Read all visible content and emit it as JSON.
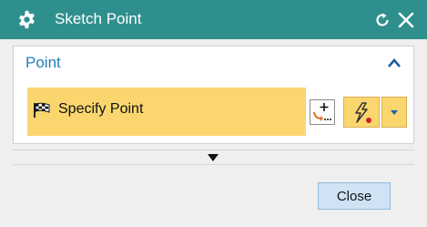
{
  "window": {
    "title": "Sketch Point",
    "icons": [
      "gear-icon",
      "reset-icon",
      "close-icon"
    ]
  },
  "group": {
    "title": "Point",
    "collapse_icon": "chevron-up-icon"
  },
  "specify_point": {
    "label": "Specify Point",
    "icon": "checkered-flag-icon",
    "point_dialog_icon": "point-dialog-icon",
    "snap_icon": "lightning-snap-icon",
    "dropdown_icon": "dropdown-arrow-icon"
  },
  "more": {
    "icon": "expand-down-icon"
  },
  "footer": {
    "close_label": "Close"
  },
  "colors": {
    "titlebar": "#2f8f8d",
    "group_title": "#1f7fb6",
    "highlight": "#fbd66f",
    "button_bg": "#cfe3f5"
  }
}
